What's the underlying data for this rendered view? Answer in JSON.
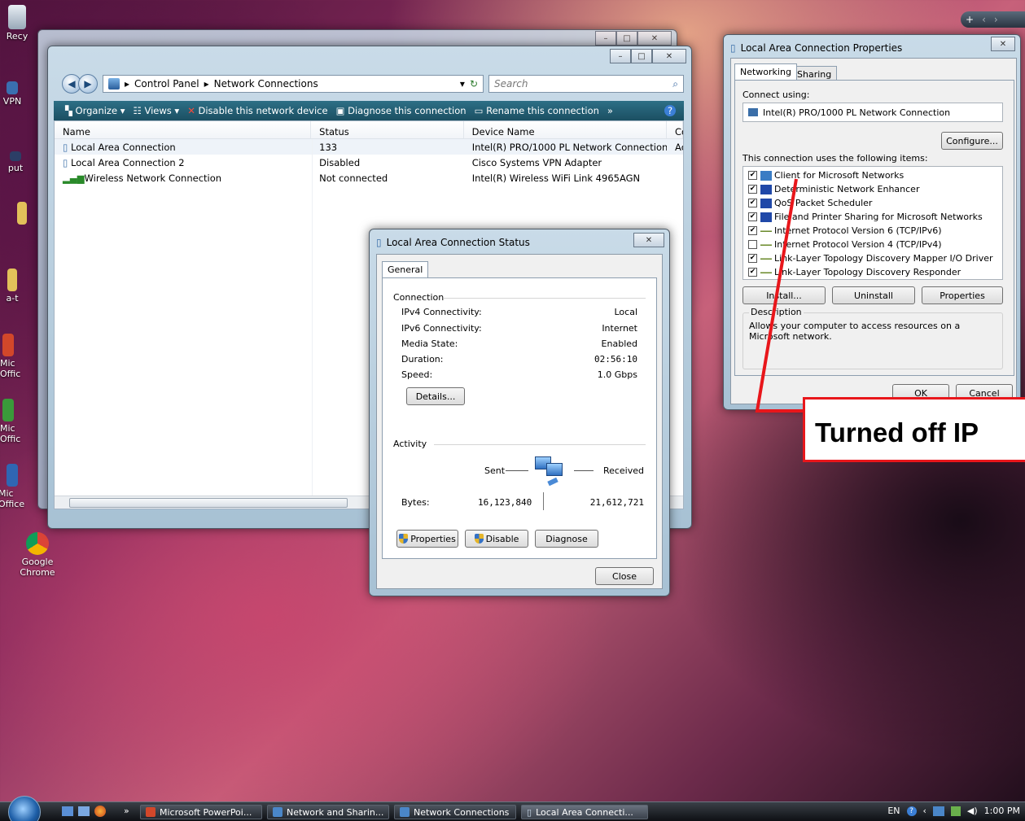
{
  "desktop": {
    "icons": [
      {
        "label": "Recy"
      },
      {
        "label": "VPN"
      },
      {
        "label": "put"
      },
      {
        "label": "a-t"
      },
      {
        "label": "Mic Offic"
      },
      {
        "label": "Mic Offic"
      },
      {
        "label": "Mic Office"
      },
      {
        "label": "Google Chrome"
      }
    ]
  },
  "explorer": {
    "breadcrumb": [
      "Control Panel",
      "Network Connections"
    ],
    "search_placeholder": "Search",
    "toolbar": {
      "organize": "Organize",
      "views": "Views",
      "disable": "Disable this network device",
      "diagnose": "Diagnose this connection",
      "rename": "Rename this connection",
      "more": "»"
    },
    "columns": [
      "Name",
      "Status",
      "Device Name",
      "Co"
    ],
    "rows": [
      {
        "name": "Local Area Connection",
        "status": "133",
        "device": "Intel(R) PRO/1000 PL Network Connection",
        "extra": "Ac"
      },
      {
        "name": "Local Area Connection 2",
        "status": "Disabled",
        "device": "Cisco Systems VPN Adapter",
        "extra": ""
      },
      {
        "name": "Wireless Network Connection",
        "status": "Not connected",
        "device": "Intel(R) Wireless WiFi Link 4965AGN",
        "extra": ""
      }
    ]
  },
  "status_dialog": {
    "title": "Local Area Connection Status",
    "tab": "General",
    "connection_label": "Connection",
    "fields": [
      {
        "label": "IPv4 Connectivity:",
        "value": "Local"
      },
      {
        "label": "IPv6 Connectivity:",
        "value": "Internet"
      },
      {
        "label": "Media State:",
        "value": "Enabled"
      },
      {
        "label": "Duration:",
        "value": "02:56:10"
      },
      {
        "label": "Speed:",
        "value": "1.0 Gbps"
      }
    ],
    "details_btn": "Details...",
    "activity_label": "Activity",
    "sent": "Sent",
    "received": "Received",
    "bytes_label": "Bytes:",
    "bytes_sent": "16,123,840",
    "bytes_received": "21,612,721",
    "properties_btn": "Properties",
    "disable_btn": "Disable",
    "diagnose_btn": "Diagnose",
    "close_btn": "Close"
  },
  "props_dialog": {
    "title": "Local Area Connection Properties",
    "tabs": [
      "Networking",
      "Sharing"
    ],
    "connect_using_label": "Connect using:",
    "adapter": "Intel(R) PRO/1000 PL Network Connection",
    "configure_btn": "Configure...",
    "items_label": "This connection uses the following items:",
    "items": [
      {
        "label": "Client for Microsoft Networks",
        "checked": true
      },
      {
        "label": "Deterministic Network Enhancer",
        "checked": true
      },
      {
        "label": "QoS Packet Scheduler",
        "checked": true
      },
      {
        "label": "File and Printer Sharing for Microsoft Networks",
        "checked": true
      },
      {
        "label": "Internet Protocol Version 6 (TCP/IPv6)",
        "checked": true
      },
      {
        "label": "Internet Protocol Version 4 (TCP/IPv4)",
        "checked": false
      },
      {
        "label": "Link-Layer Topology Discovery Mapper I/O Driver",
        "checked": true
      },
      {
        "label": "Link-Layer Topology Discovery Responder",
        "checked": true
      }
    ],
    "install_btn": "Install...",
    "uninstall_btn": "Uninstall",
    "properties_btn": "Properties",
    "description_label": "Description",
    "description": "Allows your computer to access resources on a Microsoft network.",
    "ok_btn": "OK",
    "cancel_btn": "Cancel"
  },
  "annotation": {
    "text": "Turned off IP",
    "color": "#e8161b"
  },
  "taskbar": {
    "overflow": "»",
    "buttons": [
      {
        "label": "Microsoft PowerPoi..."
      },
      {
        "label": "Network and Sharin..."
      },
      {
        "label": "Network Connections"
      },
      {
        "label": "Local Area Connecti..."
      }
    ],
    "lang": "EN",
    "time": "1:00 PM"
  }
}
